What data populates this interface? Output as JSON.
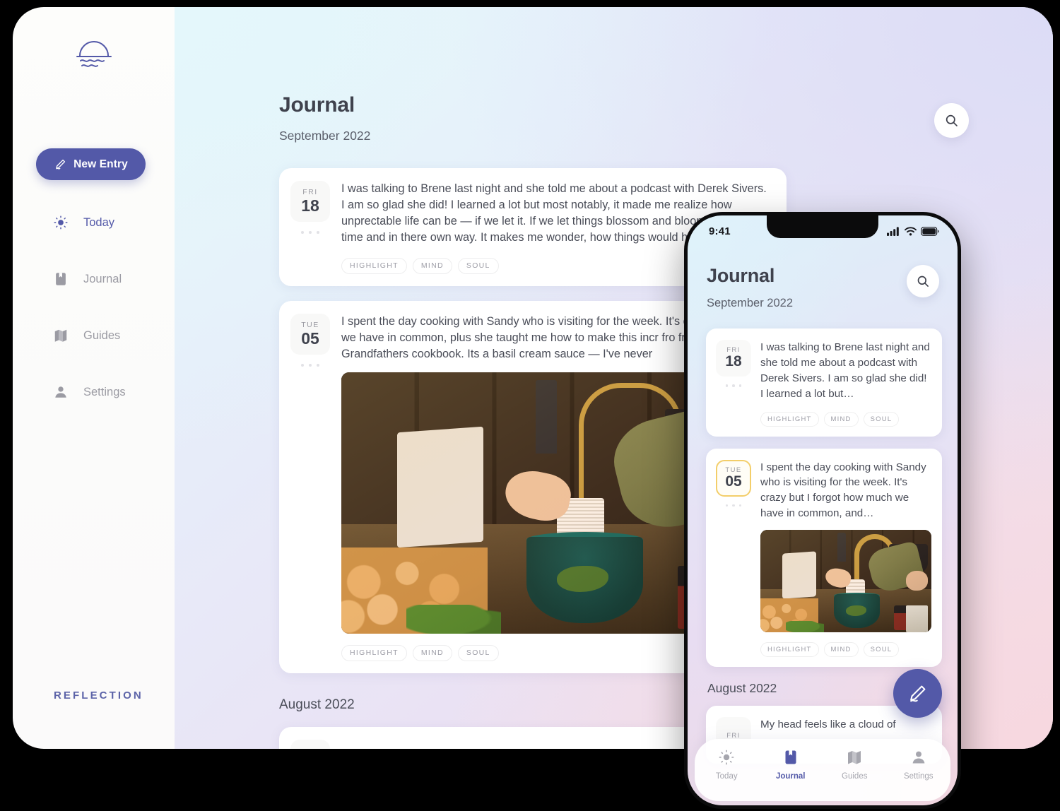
{
  "app": {
    "wordmark": "REFLECTION",
    "logo_icon": "sunset-waves-logo"
  },
  "sidebar": {
    "new_entry": {
      "label": "New Entry",
      "icon": "pencil-icon",
      "color": "#5359a8"
    },
    "items": [
      {
        "label": "Today",
        "icon": "sun-icon",
        "active": true
      },
      {
        "label": "Journal",
        "icon": "bookmark-icon",
        "active": false
      },
      {
        "label": "Guides",
        "icon": "map-icon",
        "active": false
      },
      {
        "label": "Settings",
        "icon": "person-icon",
        "active": false
      }
    ]
  },
  "desktop": {
    "title": "Journal",
    "month": "September 2022",
    "search_icon": "search-icon",
    "next_month": "August 2022",
    "entries": [
      {
        "dow": "FRI",
        "day": "18",
        "text": "I was talking to Brene last night and she told me about a podcast with Derek Sivers. I am so glad she did! I learned a lot but most notably, it made me realize how unprectable life can be — if we let it. If we let things blossom and bloom in there own time and in there own way. It makes me wonder, how things would have be",
        "tags": [
          "HIGHLIGHT",
          "MIND",
          "SOUL"
        ],
        "has_image": false
      },
      {
        "dow": "TUE",
        "day": "05",
        "text": "I spent the day cooking with Sandy who is visiting for the week. It's crazy how much we have in common, plus she taught me how to make this incr fro from her Grandfathers cookbook. Its a basil cream sauce — I've never",
        "tags": [
          "HIGHLIGHT",
          "MIND",
          "SOUL"
        ],
        "has_image": true,
        "image_alt": "kitchen-cooking-photo"
      }
    ]
  },
  "phone": {
    "status": {
      "time": "9:41",
      "signal_icon": "cellular-icon",
      "wifi_icon": "wifi-icon",
      "battery_icon": "battery-icon"
    },
    "title": "Journal",
    "month": "September 2022",
    "search_icon": "search-icon",
    "next_month": "August 2022",
    "fab_icon": "pencil-icon",
    "entries": [
      {
        "dow": "FRI",
        "day": "18",
        "text": "I was talking to Brene last night and she told me about a podcast with Derek Sivers. I am so glad she did! I learned a lot but…",
        "tags": [
          "HIGHLIGHT",
          "MIND",
          "SOUL"
        ],
        "has_image": false,
        "accent": false
      },
      {
        "dow": "TUE",
        "day": "05",
        "text": "I spent the day cooking with Sandy who is visiting for the week. It's crazy but I forgot how much we have in common, and…",
        "tags": [
          "HIGHLIGHT",
          "MIND",
          "SOUL"
        ],
        "has_image": true,
        "accent": true,
        "accent_color": "#f3ce6a",
        "image_alt": "kitchen-cooking-photo"
      },
      {
        "dow": "FRI",
        "day": "",
        "text": "My head feels like a cloud of",
        "tags": [],
        "has_image": false,
        "accent": false
      }
    ],
    "tabs": [
      {
        "label": "Today",
        "icon": "sun-icon",
        "active": false
      },
      {
        "label": "Journal",
        "icon": "bookmark-icon",
        "active": true
      },
      {
        "label": "Guides",
        "icon": "map-icon",
        "active": false
      },
      {
        "label": "Settings",
        "icon": "person-icon",
        "active": false
      }
    ]
  }
}
